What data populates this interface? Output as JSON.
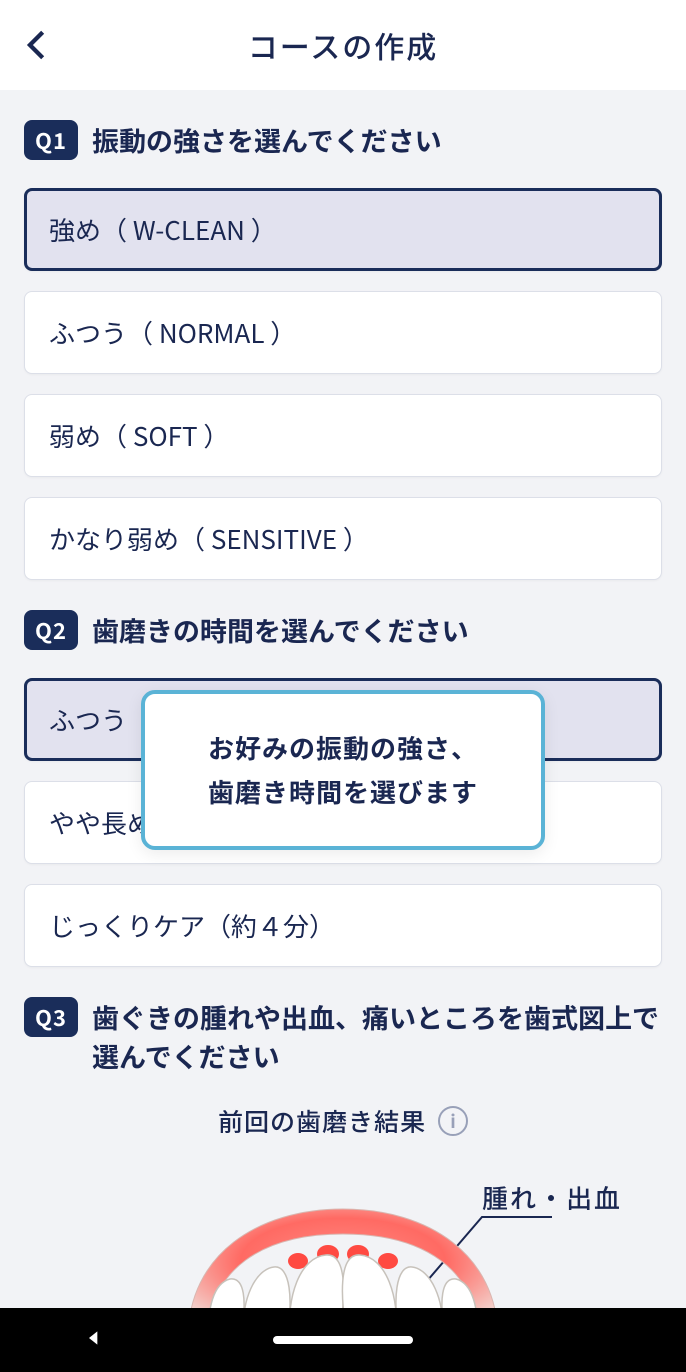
{
  "appbar": {
    "title": "コースの作成"
  },
  "q1": {
    "badge": "Q1",
    "text": "振動の強さを選んでください",
    "options": [
      "強め（ W-CLEAN ）",
      "ふつう（ NORMAL ）",
      "弱め（ SOFT ）",
      "かなり弱め（ SENSITIVE ）"
    ],
    "selected_index": 0
  },
  "q2": {
    "badge": "Q2",
    "text": "歯磨きの時間を選んでください",
    "options": [
      "ふつう",
      "やや長め（約３分）",
      "じっくりケア（約４分）"
    ],
    "selected_index": 0
  },
  "q3": {
    "badge": "Q3",
    "text": "歯ぐきの腫れや出血、痛いところを歯式図上で選んでください",
    "result_label": "前回の歯磨き結果",
    "callout_label": "腫れ・出血"
  },
  "popover": {
    "line1": "お好みの振動の強さ、",
    "line2": "歯磨き時間を選びます"
  }
}
